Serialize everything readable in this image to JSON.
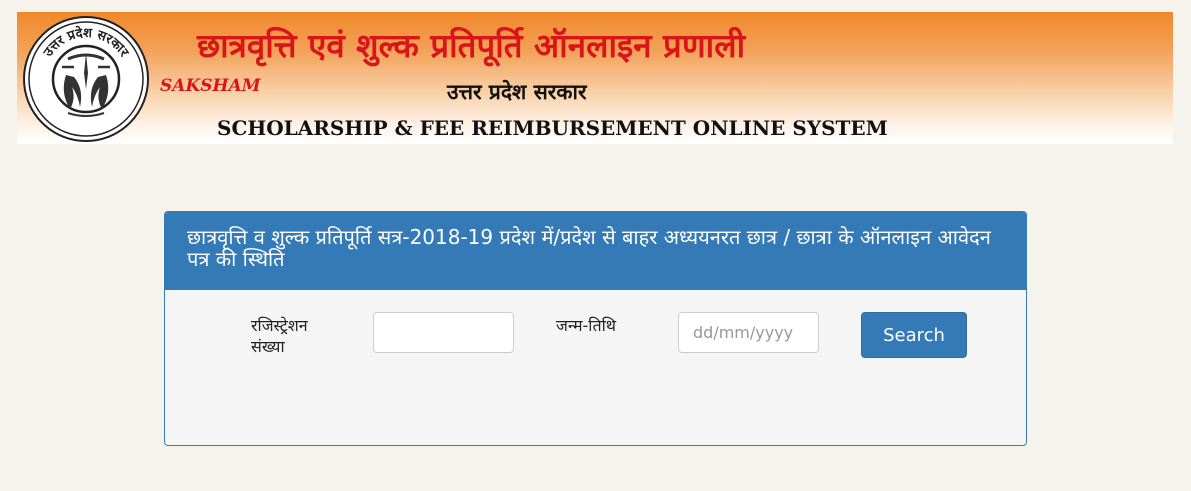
{
  "header": {
    "title_hindi": "छात्रवृत्ति एवं शुल्क प्रतिपूर्ति ऑनलाइन प्रणाली",
    "brand": "SAKSHAM",
    "government": "उत्तर प्रदेश सरकार",
    "title_english": "SCHOLARSHIP & FEE REIMBURSEMENT ONLINE SYSTEM",
    "emblem_text": "उत्तर प्रदेश सरकार"
  },
  "panel": {
    "heading": "छात्रवृत्ति व शुल्क प्रतिपूर्ति सत्र-2018-19 प्रदेश में/प्रदेश से बाहर अध्ययनरत छात्र / छात्रा के ऑनलाइन आवेदन पत्र की स्थिति"
  },
  "form": {
    "registration_label": "रजिस्ट्रेशन संख्या",
    "registration_value": "",
    "dob_label": "जन्म-तिथि",
    "dob_placeholder": "dd/mm/yyyy",
    "search_label": "Search"
  },
  "colors": {
    "primary": "#337ab7",
    "title_red": "#d8161a",
    "header_orange": "#f0882a",
    "page_bg": "#f6f3ed"
  }
}
